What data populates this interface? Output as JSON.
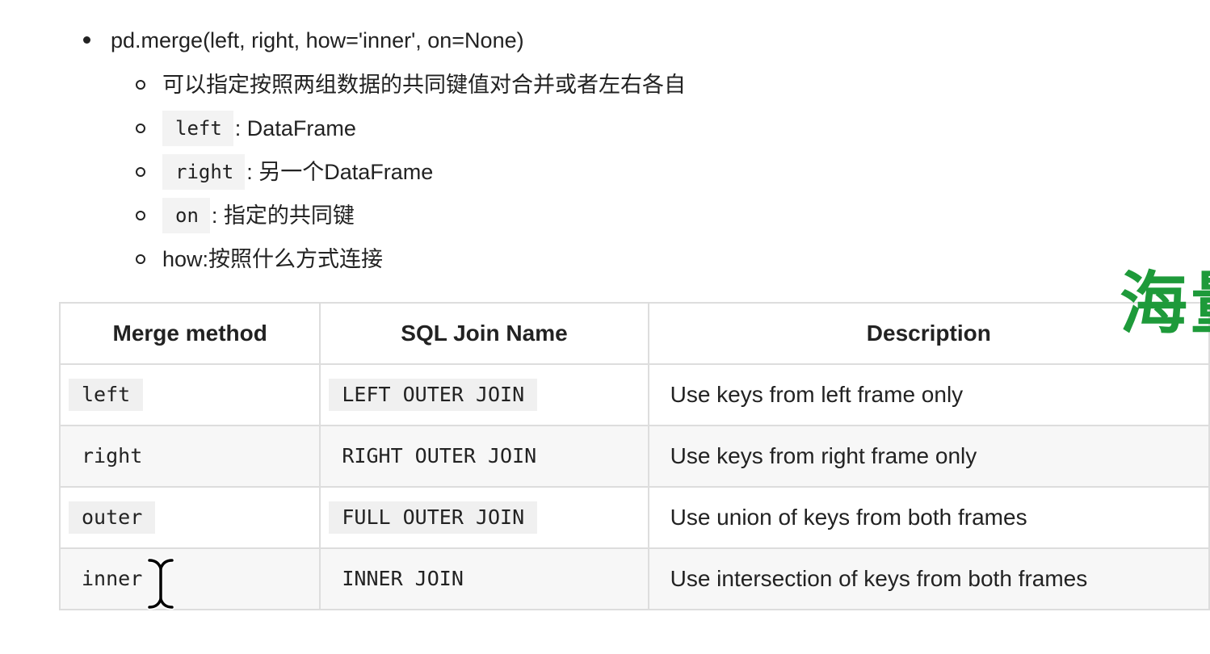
{
  "bullets": {
    "main": "pd.merge(left, right, how='inner', on=None)",
    "sub": [
      {
        "code": "",
        "text": "可以指定按照两组数据的共同键值对合并或者左右各自"
      },
      {
        "code": "left",
        "text": ": DataFrame"
      },
      {
        "code": "right",
        "text": ": 另一个DataFrame"
      },
      {
        "code": "on",
        "text": ": 指定的共同键"
      },
      {
        "code": "",
        "text": "how:按照什么方式连接"
      }
    ]
  },
  "table": {
    "headers": [
      "Merge method",
      "SQL Join Name",
      "Description"
    ],
    "rows": [
      {
        "method": "left",
        "sql": "LEFT OUTER JOIN",
        "desc": "Use keys from left frame only"
      },
      {
        "method": "right",
        "sql": "RIGHT OUTER JOIN",
        "desc": "Use keys from right frame only"
      },
      {
        "method": "outer",
        "sql": "FULL OUTER JOIN",
        "desc": "Use union of keys from both frames"
      },
      {
        "method": "inner",
        "sql": "INNER JOIN",
        "desc": "Use intersection of keys from both frames"
      }
    ]
  },
  "watermark": {
    "text": "海量",
    "color": "#1e9a3a"
  },
  "cursor": {
    "icon": "text-cursor-icon"
  }
}
